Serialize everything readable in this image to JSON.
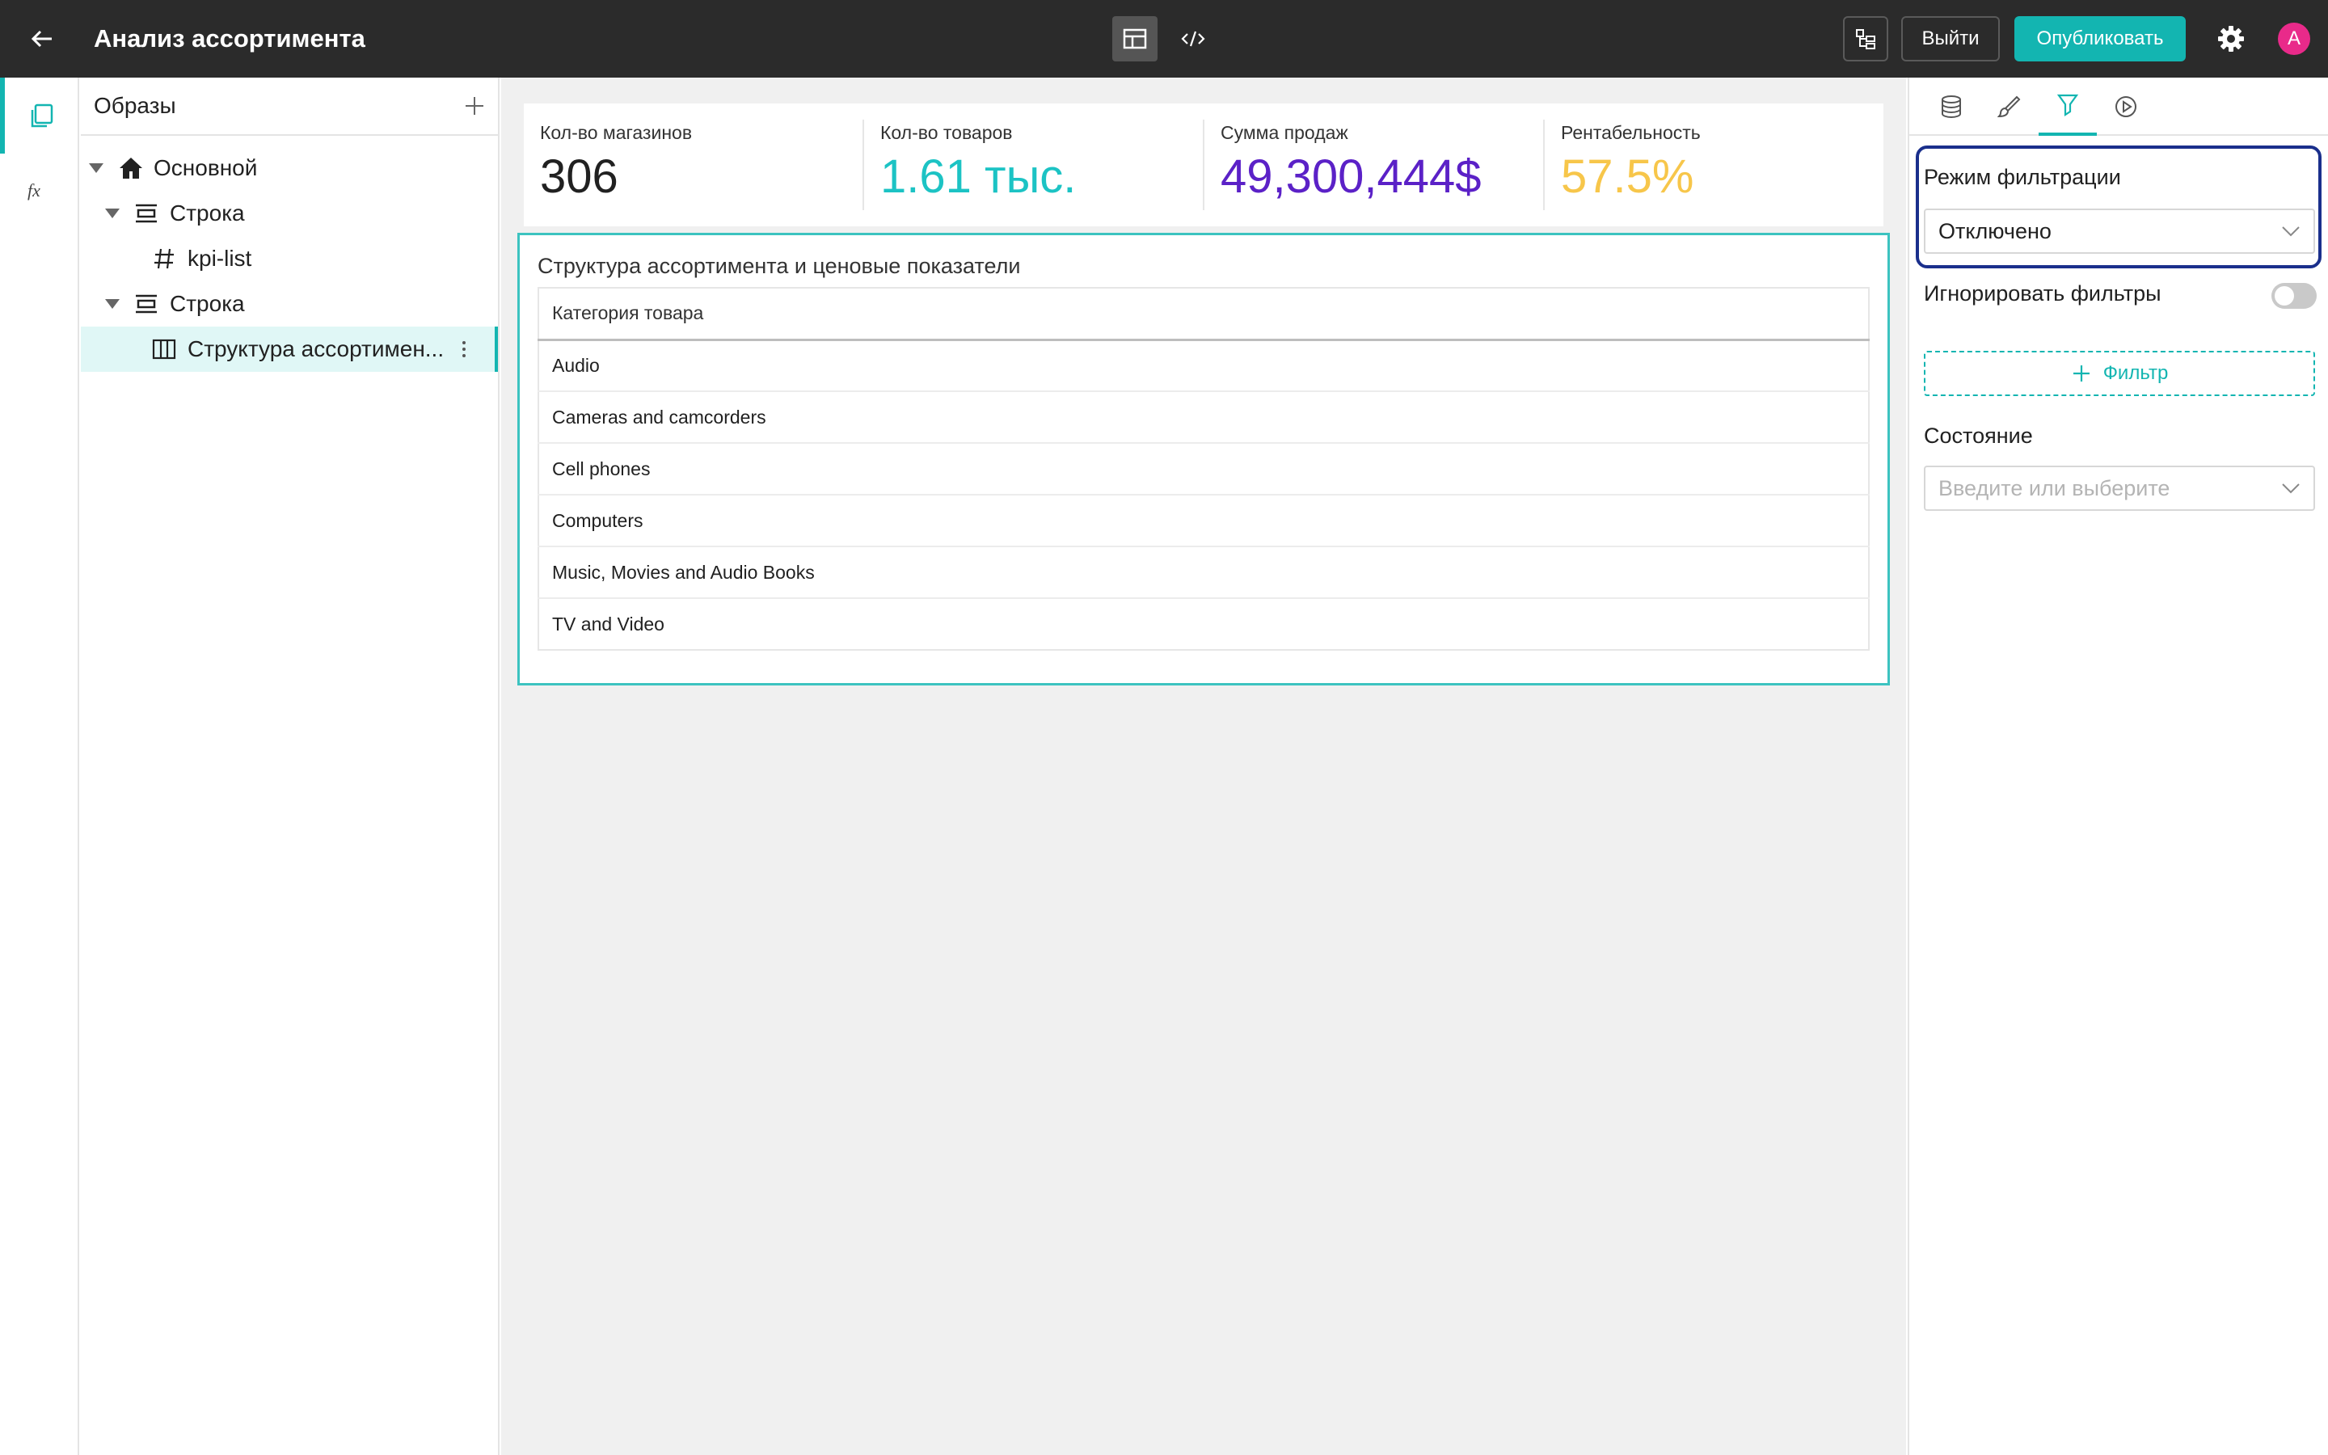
{
  "app": {
    "title": "Анализ ассортимента"
  },
  "toolbar": {
    "exit_label": "Выйти",
    "publish_label": "Опубликовать",
    "avatar_letter": "A",
    "publish_color": "#13b5b1"
  },
  "tree": {
    "title": "Образы",
    "nodes": [
      {
        "label": "Основной",
        "icon": "home-icon"
      },
      {
        "label": "Строка",
        "icon": "row-icon"
      },
      {
        "label": "kpi-list",
        "icon": "hash-icon"
      },
      {
        "label": "Строка",
        "icon": "row-icon"
      },
      {
        "label": "Структура ассортимен...",
        "icon": "table-icon"
      }
    ]
  },
  "kpis": [
    {
      "label": "Кол-во магазинов",
      "value": "306",
      "color": "#212121"
    },
    {
      "label": "Кол-во товаров",
      "value": "1.61 тыс.",
      "color": "#1cc3c4"
    },
    {
      "label": "Сумма продаж",
      "value": "49,300,444$",
      "color": "#5b21c7"
    },
    {
      "label": "Рентабельность",
      "value": "57.5%",
      "color": "#f7c64a"
    }
  ],
  "widget": {
    "title": "Структура ассортимента и ценовые показатели",
    "column_header": "Категория товара",
    "rows": [
      "Audio",
      "Cameras and camcorders",
      "Cell phones",
      "Computers",
      "Music, Movies and Audio Books",
      "TV and Video"
    ]
  },
  "props": {
    "filter_mode_label": "Режим фильтрации",
    "filter_mode_value": "Отключено",
    "ignore_filters_label": "Игнорировать фильтры",
    "ignore_filters_on": false,
    "add_filter_label": "Фильтр",
    "state_label": "Состояние",
    "state_placeholder": "Введите или выберите"
  }
}
